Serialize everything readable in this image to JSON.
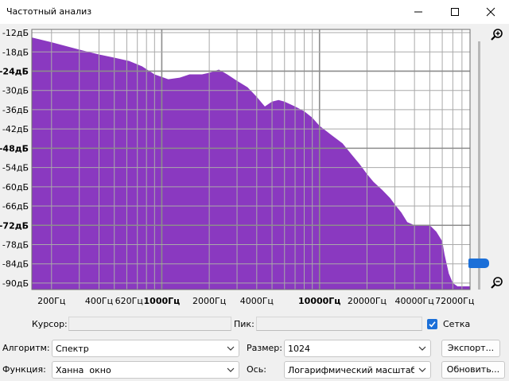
{
  "window": {
    "title": "Частотный анализ",
    "minimize_icon": "minimize-icon",
    "maximize_icon": "maximize-icon",
    "close_icon": "close-icon"
  },
  "colors": {
    "spectrum_fill": "#8a39c0",
    "accent": "#1b6fd8",
    "grid": "#a9a9a9"
  },
  "chart_data": {
    "type": "area",
    "x_scale": "log",
    "xlim": [
      150,
      90000
    ],
    "ylim": [
      -92,
      -11
    ],
    "grid": true,
    "y_ticks": [
      "-12дБ",
      "-18дБ",
      "-24дБ",
      "-30дБ",
      "-36дБ",
      "-42дБ",
      "-48дБ",
      "-54дБ",
      "-60дБ",
      "-66дБ",
      "-72дБ",
      "-78дБ",
      "-84дБ",
      "-90дБ"
    ],
    "y_tick_values": [
      -12,
      -18,
      -24,
      -30,
      -36,
      -42,
      -48,
      -54,
      -60,
      -66,
      -72,
      -78,
      -84,
      -90
    ],
    "x_ticks": [
      "200Гц",
      "400Гц",
      "620Гц",
      "1000Гц",
      "2000Гц",
      "4000Гц",
      "10000Гц",
      "20000Гц",
      "40000Гц",
      "72000Гц"
    ],
    "x_tick_values": [
      200,
      400,
      620,
      1000,
      2000,
      4000,
      10000,
      20000,
      40000,
      72000
    ],
    "series": [
      {
        "x": [
          150,
          200,
          300,
          400,
          500,
          620,
          750,
          900,
          1100,
          1300,
          1500,
          1800,
          2000,
          2300,
          2600,
          3000,
          3500,
          4000,
          4500,
          5000,
          5500,
          6000,
          7000,
          8000,
          9000,
          10000,
          12000,
          14000,
          16000,
          18000,
          20000,
          22000,
          25000,
          28000,
          30000,
          33000,
          36000,
          40000,
          45000,
          50000,
          55000,
          60000,
          62000,
          64000,
          66000,
          70000,
          75000,
          80000,
          85000,
          90000
        ],
        "y": [
          -13.5,
          -15,
          -17.3,
          -18.8,
          -19.8,
          -20.8,
          -22.5,
          -25,
          -26.5,
          -26,
          -25,
          -25,
          -24.5,
          -23.5,
          -25,
          -27,
          -29,
          -32,
          -35,
          -33.5,
          -33,
          -33.5,
          -35,
          -36.5,
          -38.5,
          -41,
          -44,
          -46.5,
          -50,
          -53,
          -56,
          -58.5,
          -61,
          -63.5,
          -65.5,
          -68,
          -71,
          -72,
          -72,
          -72,
          -74,
          -77,
          -81,
          -84,
          -87,
          -90,
          -91,
          -91,
          -91,
          -91
        ]
      }
    ]
  },
  "zoom": {
    "zoom_in_icon": "zoom-in-icon",
    "zoom_out_icon": "zoom-out-icon",
    "level": 0.88
  },
  "controls": {
    "cursor_label": "Курсор:",
    "cursor_value": "",
    "peak_label": "Пик:",
    "peak_value": "",
    "grid_label": "Сетка",
    "grid_checked": true,
    "algorithm_label": "Алгоритм:",
    "algorithm_value": "Спектр",
    "size_label": "Размер:",
    "size_value": "1024",
    "export_label": "Экспорт...",
    "function_label": "Функция:",
    "function_value": "Ханна  окно",
    "axis_label": "Ось:",
    "axis_value": "Логарифмический масштаб",
    "refresh_label": "Обновить..."
  }
}
